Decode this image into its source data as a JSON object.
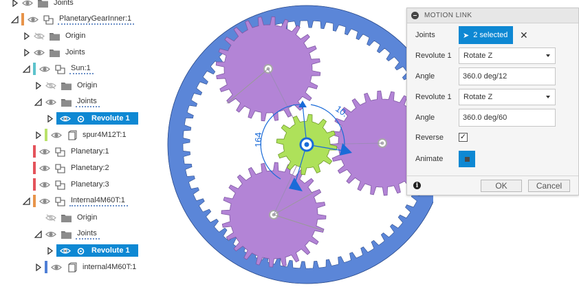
{
  "tree": {
    "rows": [
      {
        "label": "Joints",
        "indent": 0,
        "toggle": "collapsed",
        "vis": "eye",
        "icon": "folder",
        "bar": "",
        "selected": false,
        "dotted": false
      },
      {
        "label": "PlanetaryGearInner:1",
        "indent": 0,
        "toggle": "expanded",
        "vis": "eye",
        "icon": "component",
        "bar": "#e8944a",
        "selected": false,
        "dotted": true
      },
      {
        "label": "Origin",
        "indent": 1,
        "toggle": "collapsed",
        "vis": "hidden",
        "icon": "folder",
        "bar": "",
        "selected": false,
        "dotted": false
      },
      {
        "label": "Joints",
        "indent": 1,
        "toggle": "collapsed",
        "vis": "eye",
        "icon": "folder",
        "bar": "",
        "selected": false,
        "dotted": false
      },
      {
        "label": "Sun:1",
        "indent": 1,
        "toggle": "expanded",
        "vis": "eye",
        "icon": "component",
        "bar": "#5dc3cc",
        "selected": false,
        "dotted": true
      },
      {
        "label": "Origin",
        "indent": 2,
        "toggle": "collapsed",
        "vis": "hidden",
        "icon": "folder",
        "bar": "",
        "selected": false,
        "dotted": false
      },
      {
        "label": "Joints",
        "indent": 2,
        "toggle": "expanded",
        "vis": "eye",
        "icon": "folder",
        "bar": "",
        "selected": false,
        "dotted": true
      },
      {
        "label": "Revolute 1",
        "indent": 3,
        "toggle": "collapsed",
        "vis": "eye",
        "icon": "joint",
        "bar": "",
        "selected": true,
        "dotted": false
      },
      {
        "label": "spur4M12T:1",
        "indent": 2,
        "toggle": "collapsed",
        "vis": "eye",
        "icon": "body",
        "bar": "#b9e26a",
        "selected": false,
        "dotted": false
      },
      {
        "label": "Planetary:1",
        "indent": 1,
        "toggle": "none",
        "vis": "eye",
        "icon": "component",
        "bar": "#e4535b",
        "selected": false,
        "dotted": false
      },
      {
        "label": "Planetary:2",
        "indent": 1,
        "toggle": "none",
        "vis": "eye",
        "icon": "component",
        "bar": "#e4535b",
        "selected": false,
        "dotted": false
      },
      {
        "label": "Planetary:3",
        "indent": 1,
        "toggle": "none",
        "vis": "eye",
        "icon": "component",
        "bar": "#e4535b",
        "selected": false,
        "dotted": false
      },
      {
        "label": "Internal4M60T:1",
        "indent": 1,
        "toggle": "expanded",
        "vis": "eye",
        "icon": "component",
        "bar": "#e8944a",
        "selected": false,
        "dotted": true
      },
      {
        "label": "Origin",
        "indent": 2,
        "toggle": "none",
        "vis": "hidden",
        "icon": "folder",
        "bar": "",
        "selected": false,
        "dotted": false
      },
      {
        "label": "Joints",
        "indent": 2,
        "toggle": "expanded",
        "vis": "eye",
        "icon": "folder",
        "bar": "",
        "selected": false,
        "dotted": true
      },
      {
        "label": "Revolute 1",
        "indent": 3,
        "toggle": "collapsed",
        "vis": "eye",
        "icon": "joint",
        "bar": "",
        "selected": true,
        "dotted": false
      },
      {
        "label": "internal4M60T:1",
        "indent": 2,
        "toggle": "collapsed",
        "vis": "eye",
        "icon": "body",
        "bar": "#4f7fd6",
        "selected": false,
        "dotted": false
      }
    ]
  },
  "viewport": {
    "dimension_left": "164",
    "dimension_top": "10.",
    "colors": {
      "ring": "#5b86d8",
      "planet": "#b384d6",
      "sun": "#aee15a",
      "joint": "#1a6bd8"
    }
  },
  "dialog": {
    "title": "MOTION LINK",
    "joints_label": "Joints",
    "joints_value": "2 selected",
    "revolute1_label": "Revolute 1",
    "revolute1_value": "Rotate Z",
    "angle1_label": "Angle",
    "angle1_value": "360.0 deg/12",
    "revolute2_label": "Revolute 1",
    "revolute2_value": "Rotate Z",
    "angle2_label": "Angle",
    "angle2_value": "360.0 deg/60",
    "reverse_label": "Reverse",
    "reverse_checked": true,
    "animate_label": "Animate",
    "ok_label": "OK",
    "cancel_label": "Cancel"
  }
}
